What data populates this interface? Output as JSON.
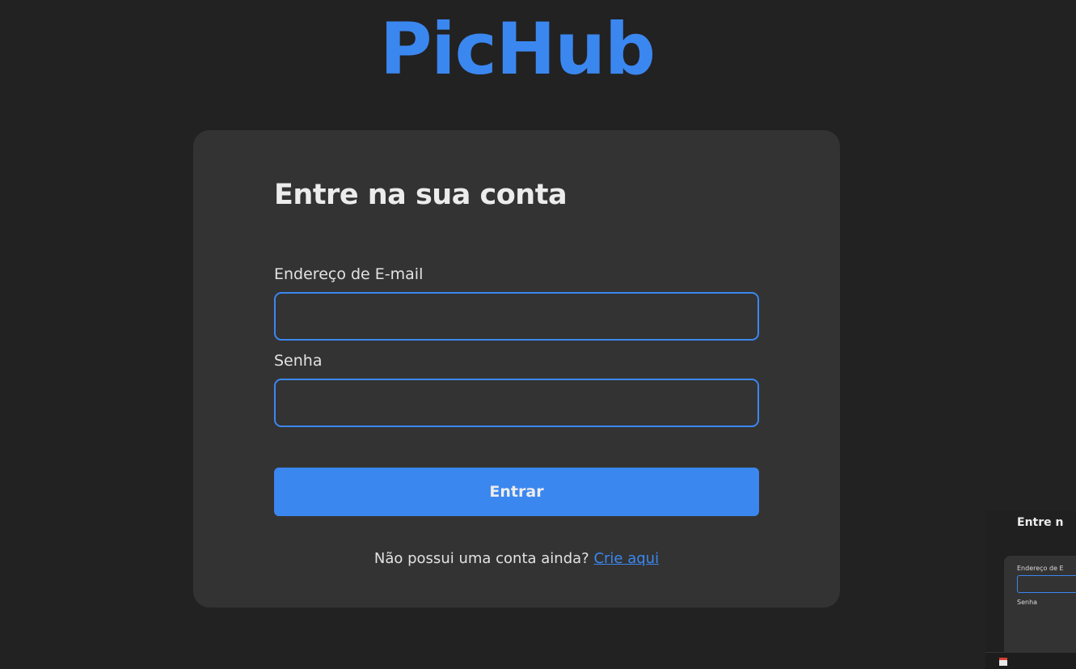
{
  "brand": {
    "title": "PicHub",
    "color": "#3b87f0"
  },
  "login": {
    "heading": "Entre na sua conta",
    "email_label": "Endereço de E-mail",
    "email_value": "",
    "password_label": "Senha",
    "password_value": "",
    "submit_label": "Entrar",
    "signup_prompt": "Não possui uma conta ainda?",
    "signup_link": "Crie aqui"
  },
  "preview_thumbnail": {
    "heading": "Entre n",
    "email_label": "Endereço de E",
    "password_label": "Senha",
    "taskbar_icon": "app-icon"
  },
  "colors": {
    "background": "#222222",
    "card": "#333333",
    "accent": "#3b87f0",
    "text": "#e2e2e2"
  }
}
